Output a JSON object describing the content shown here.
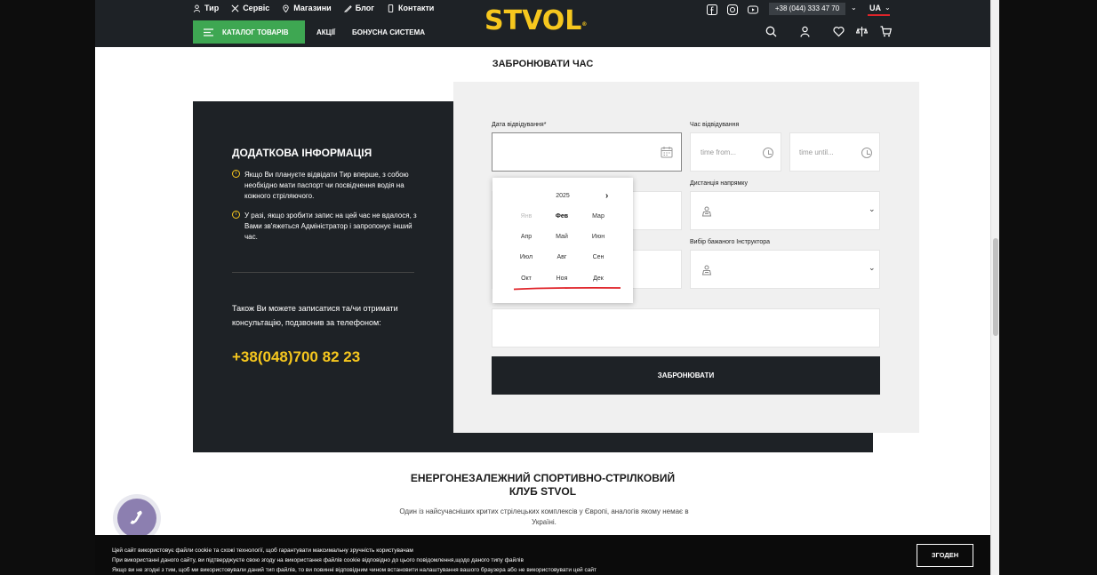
{
  "header": {
    "top_links": [
      {
        "label": "Тир",
        "icon": "user-icon"
      },
      {
        "label": "Сервіс",
        "icon": "tools-icon"
      },
      {
        "label": "Магазини",
        "icon": "location-pin-icon"
      },
      {
        "label": "Блог",
        "icon": "pen-icon"
      },
      {
        "label": "Контакти",
        "icon": "phone-icon"
      }
    ],
    "logo": "STVOL",
    "logo_mark": "®",
    "catalog_label": "КАТАЛОГ ТОВАРІВ",
    "nav": [
      "АКЦІЇ",
      "БОНУСНА СИСТЕМА"
    ],
    "phone": "+38 (044) 333 47 70",
    "lang": "UA",
    "colors": {
      "dark": "#1e2226",
      "brand_yellow": "#f6c71e",
      "catalog_green": "#3ea752",
      "accent_red": "#e0242a"
    }
  },
  "booking": {
    "title": "ЗАБРОНЮВАТИ ЧАС",
    "date_label": "Дата відвідування*",
    "time_label": "Час відвідування",
    "time_from_placeholder": "time from...",
    "time_until_placeholder": "time until...",
    "distance_label": "Дистанція напрямку",
    "instructor_label": "Вибір бажаного Інструктора",
    "submit_label": "ЗАБРОНЮВАТИ"
  },
  "datepicker": {
    "year": "2025",
    "months": [
      "Янв",
      "Фев",
      "Мар",
      "Апр",
      "Май",
      "Июн",
      "Июл",
      "Авг",
      "Сен",
      "Окт",
      "Ноя",
      "Дек"
    ],
    "disabled": [
      "Янв"
    ],
    "selected": "Фев"
  },
  "info": {
    "title": "ДОДАТКОВА ІНФОРМАЦІЯ",
    "item1": "Якщо Ви плануєте відвідати Тир вперше, з собою необхідно мати паспорт чи посвідчення водія на кожного стріляючого.",
    "item2": "У разі, якщо зробити запис на цей час не вдалося, з Вами зв'яжеться Адміністратор і запропонує інший час.",
    "contact_text": "Також Ви можете записатися та/чи отримати консультацію, подзвонив за телефоном:",
    "phone": "+38(048)700 82 23"
  },
  "club": {
    "title_line1": "ЕНЕРГОНЕЗАЛЕЖНИЙ СПОРТИВНО-СТРІЛКОВИЙ",
    "title_line2": "КЛУБ STVOL",
    "desc": "Один із найсучасніших критих стрілецьких комплексів у Європі, аналогів якому немає в Україні."
  },
  "cookie": {
    "line1": "Цей сайт використовує файли cookie та схожі технології, щоб гарантувати максимальну зручність користувачам",
    "line2": "При використанні даного сайту, ви підтверджуєте свою згоду на використання файлів cookie відповідно до цього повідомлення,щодо даного типу файлів",
    "line3": "Якщо ви не згодні з тим, щоб ми використовували даний тип файлів, то ви повинні відповідним чином встановити налаштування вашого браузера або не використовувати цей сайт",
    "accept_label": "згоден"
  }
}
